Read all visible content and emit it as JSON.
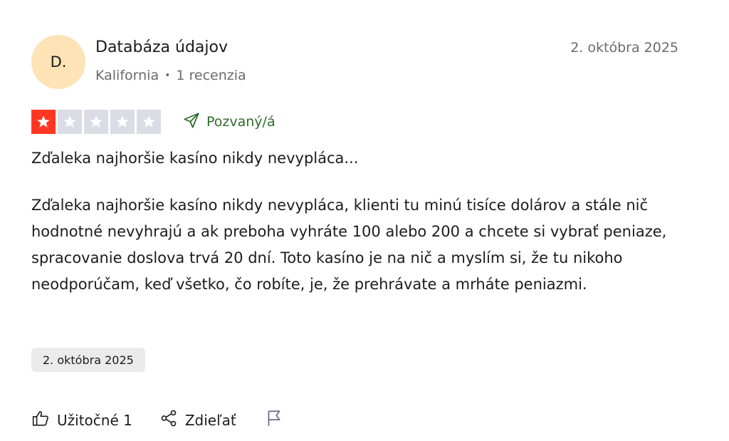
{
  "reviewer": {
    "initials": "D.",
    "name": "Databáza údajov",
    "location": "Kalifornia",
    "separator": "•",
    "review_count": "1 recenzia"
  },
  "header_date": "2. októbra 2025",
  "rating": {
    "stars": 1,
    "max": 5
  },
  "colors": {
    "star_filled": "#ff3722",
    "star_empty": "#dcdce6",
    "invited": "#2f6b2a",
    "avatar_bg": "#fde3b5"
  },
  "invited_label": "Pozvaný/á",
  "review": {
    "title": "Zďaleka najhoršie kasíno nikdy nevypláca...",
    "body": "Zďaleka najhoršie kasíno nikdy nevypláca, klienti tu minú tisíce dolárov a stále nič hodnotné nevyhrajú a ak preboha vyhráte 100 alebo 200 a chcete si vybrať peniaze, spracovanie doslova trvá 20 dní. Toto kasíno je na nič a myslím si, že tu nikoho neodporúčam, keď všetko, čo robíte, je, že prehrávate a mrháte peniazmi.",
    "experience_date": "2. októbra 2025"
  },
  "actions": {
    "useful_label": "Užitočné 1",
    "share_label": "Zdieľať",
    "icons": [
      "thumbs-up-icon",
      "share-icon",
      "flag-icon"
    ]
  }
}
